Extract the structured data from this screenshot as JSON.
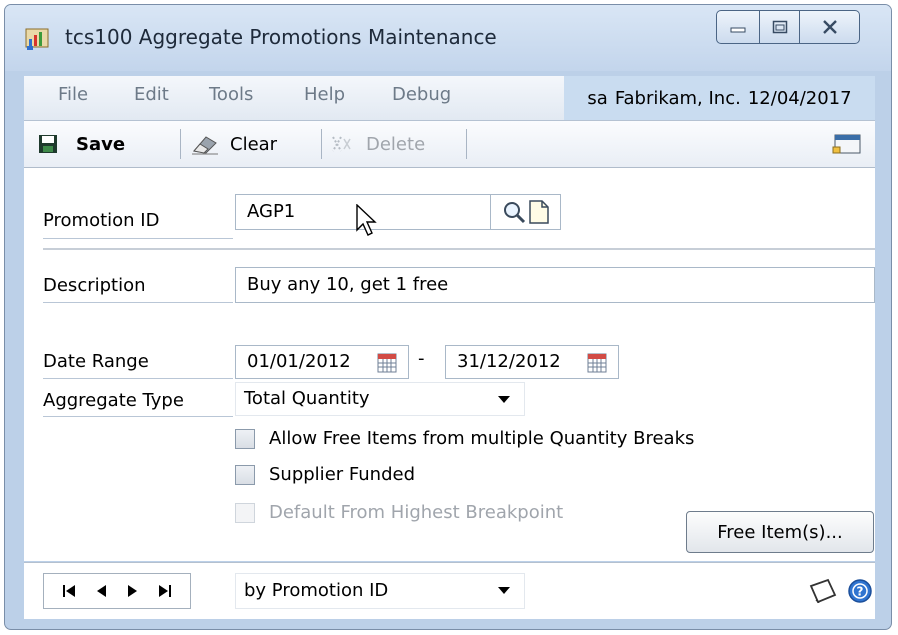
{
  "window": {
    "title": "tcs100 Aggregate Promotions Maintenance"
  },
  "menu": {
    "items": [
      "File",
      "Edit",
      "Tools",
      "Help",
      "Debug"
    ]
  },
  "user_info": {
    "user": "sa",
    "company": "Fabrikam, Inc.",
    "date": "12/04/2017"
  },
  "toolbar": {
    "save_label": "Save",
    "clear_label": "Clear",
    "delete_label": "Delete"
  },
  "form": {
    "promotion_id": {
      "label": "Promotion ID",
      "value": "AGP1"
    },
    "description": {
      "label": "Description",
      "value": "Buy any 10, get 1 free"
    },
    "date_range": {
      "label": "Date Range",
      "start": "01/01/2012",
      "end": "31/12/2012",
      "separator": "-"
    },
    "aggregate_type": {
      "label": "Aggregate Type",
      "value": "Total Quantity"
    },
    "checkboxes": {
      "allow_free_items": {
        "label": "Allow Free Items from multiple Quantity Breaks",
        "checked": false
      },
      "supplier_funded": {
        "label": "Supplier Funded",
        "checked": false
      },
      "default_highest": {
        "label": "Default From Highest Breakpoint",
        "checked": false,
        "disabled": true
      }
    },
    "free_items_button": "Free Item(s)..."
  },
  "bottom": {
    "sort_by": "by Promotion ID"
  },
  "colors": {
    "window_frame": "#bcd0e8",
    "user_info_bg": "#c9dcf0",
    "help_icon": "#2f74d0"
  }
}
